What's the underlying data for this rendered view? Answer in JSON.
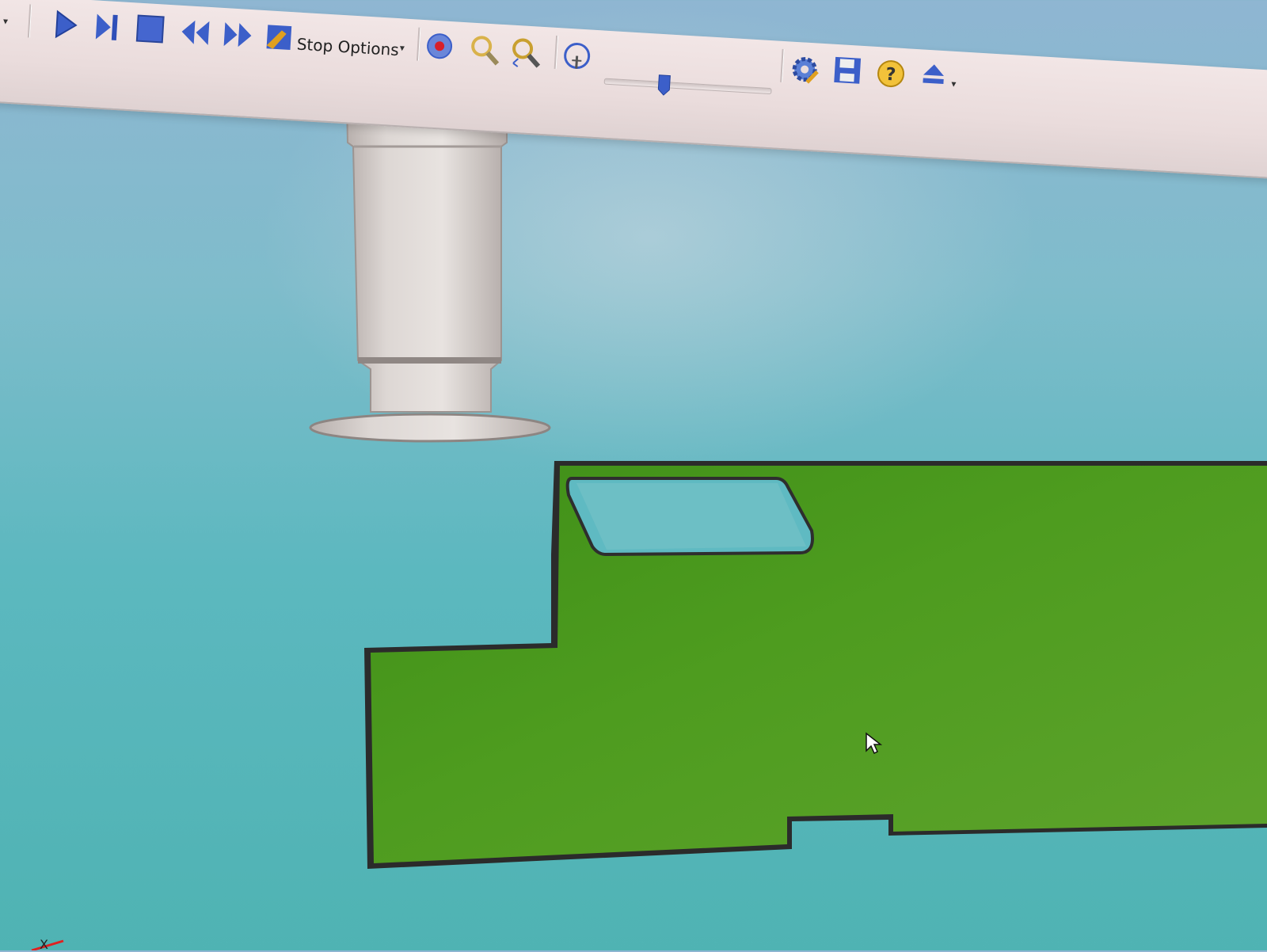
{
  "toolbar": {
    "stop_options_label": "Stop Options",
    "buttons": [
      {
        "icon": "play-icon"
      },
      {
        "icon": "step-icon"
      },
      {
        "icon": "stop-icon"
      },
      {
        "icon": "rewind-icon"
      },
      {
        "icon": "fast-forward-icon"
      },
      {
        "icon": "stop-options-icon"
      },
      {
        "icon": "record-icon"
      },
      {
        "icon": "zoom-icon"
      },
      {
        "icon": "zoom-fit-icon"
      },
      {
        "icon": "speed-icon"
      },
      {
        "icon": "settings-gear-icon"
      },
      {
        "icon": "save-icon"
      },
      {
        "icon": "help-icon"
      },
      {
        "icon": "eject-icon"
      }
    ],
    "colors": {
      "blue_icon": "#3c5fc9",
      "toolbar_bg": "#eadcdc"
    }
  },
  "viewport": {
    "axis_label": "X",
    "colors": {
      "background": "#5cb8bf",
      "workpiece": "#4f9a22",
      "tool": "#c9c2bf"
    }
  }
}
